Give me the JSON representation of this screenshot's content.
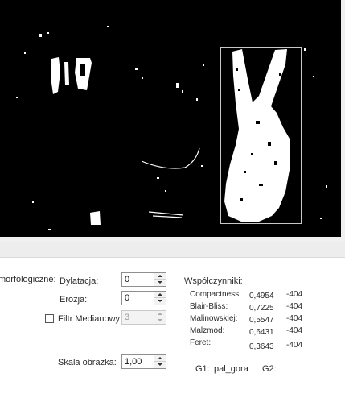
{
  "morph": {
    "group_label": "morfologiczne:",
    "dilation_label": "Dylatacja:",
    "dilation_value": "0",
    "erosion_label": "Erozja:",
    "erosion_value": "0",
    "median_label": "Filtr Medianowy:",
    "median_checked": false,
    "median_value": "3"
  },
  "scale": {
    "label": "Skala obrazka:",
    "value": "1,00"
  },
  "coefficients": {
    "title": "Współczynniki:",
    "rows": [
      {
        "name": "Compactness:",
        "value": "0,4954",
        "extra": "-404"
      },
      {
        "name": "Blair-Bliss:",
        "value": "0,7225",
        "extra": "-404"
      },
      {
        "name": "Malinowskiej:",
        "value": "0,5547",
        "extra": "-404"
      },
      {
        "name": "Malzmod:",
        "value": "0,6431",
        "extra": "-404"
      },
      {
        "name": "Feret:",
        "value": "0,3643",
        "extra": "-404"
      }
    ]
  },
  "gestures": {
    "g1_label": "G1:",
    "g1_value": "pal_gora",
    "g2_label": "G2:"
  },
  "colors": {
    "preview_bg": "#000000",
    "bbox": "#c8c8c8"
  }
}
